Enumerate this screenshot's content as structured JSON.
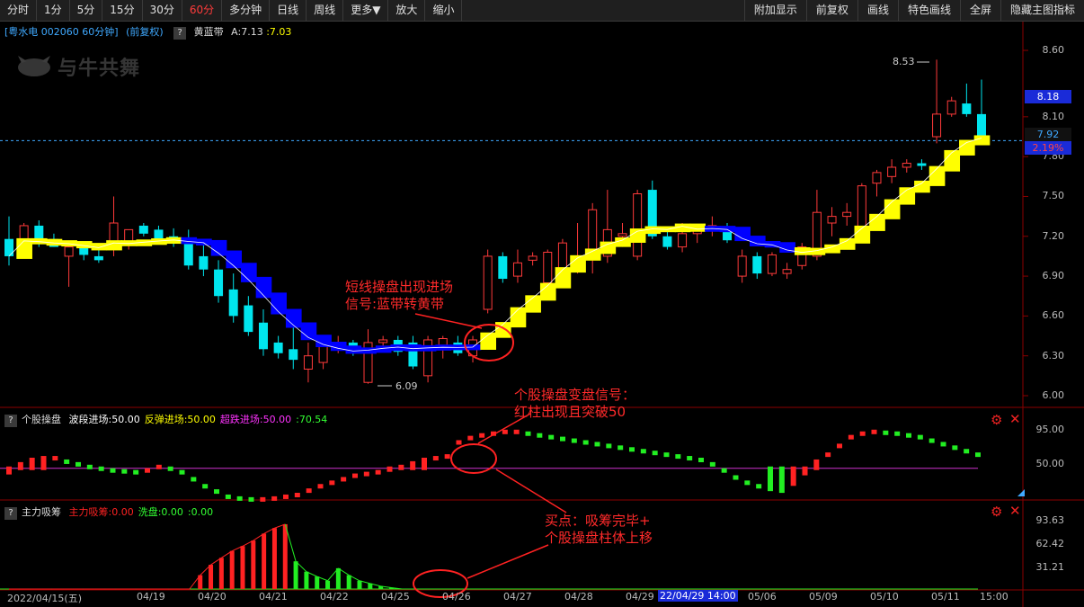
{
  "toolbar": {
    "left_items": [
      "分时",
      "1分",
      "5分",
      "15分",
      "30分",
      "60分",
      "多分钟",
      "日线",
      "周线",
      "更多▼",
      "放大",
      "缩小"
    ],
    "active": "60分",
    "right_items": [
      "附加显示",
      "前复权",
      "画线",
      "特色画线",
      "全屏",
      "隐藏主图指标"
    ]
  },
  "main_legend": {
    "stock": "[粤水电 002060 60分钟]",
    "adjust": "(前复权)",
    "indicator": "黄蓝带",
    "a_label": "A:7.13",
    "b_label": ":7.03"
  },
  "watermark": "与牛共舞",
  "price_axis": {
    "labels": [
      "8.60",
      "8.10",
      "7.80",
      "7.50",
      "7.20",
      "6.90",
      "6.60",
      "6.30",
      "6.00"
    ]
  },
  "price_tags": {
    "high": "8.18",
    "last": "7.92",
    "pct": "2.19%"
  },
  "price_annotations": {
    "high_mark": "8.53",
    "low_mark": "6.09"
  },
  "panel2": {
    "name": "个股操盘",
    "items": [
      {
        "label": "波段进场:50.00",
        "color": "#ffffff"
      },
      {
        "label": "反弹进场:50.00",
        "color": "#ffff00"
      },
      {
        "label": "超跌进场:50.00",
        "color": "#ff33ff"
      },
      {
        "label": ":70.54",
        "color": "#33ff33"
      }
    ],
    "axis": [
      "95.00",
      "50.00"
    ]
  },
  "panel3": {
    "name": "主力吸筹",
    "items": [
      {
        "label": "主力吸筹:0.00",
        "color": "#ff2222"
      },
      {
        "label": "洗盘:0.00",
        "color": "#33ff33"
      },
      {
        "label": ":0.00",
        "color": "#33ff33"
      }
    ],
    "axis": [
      "93.63",
      "62.42",
      "31.21"
    ]
  },
  "x_axis": {
    "labels": [
      "2022/04/15(五)",
      "04/19",
      "04/20",
      "04/21",
      "04/22",
      "04/25",
      "04/26",
      "04/27",
      "04/28",
      "04/29",
      "05/06",
      "05/09",
      "05/10",
      "05/11",
      "15:00"
    ],
    "cursor_label": "22/04/29 14:00"
  },
  "annotations": {
    "signal1": [
      "短线操盘出现进场",
      "信号:蓝带转黄带"
    ],
    "signal2": [
      "个股操盘变盘信号：",
      "红柱出现且突破50"
    ],
    "signal3": [
      "买点：吸筹完毕+",
      "个股操盘柱体上移"
    ]
  },
  "colors": {
    "up": "#ff3a3a",
    "down": "#00e5ee",
    "yellow_band": "#ffff00",
    "blue_band": "#0000ff",
    "grid": "#8b0000"
  },
  "chart_data": {
    "type": "candlestick",
    "ohlc": [
      [
        7.18,
        7.35,
        6.98,
        7.05
      ],
      [
        7.15,
        7.3,
        7.05,
        7.28
      ],
      [
        7.28,
        7.32,
        7.12,
        7.15
      ],
      [
        7.18,
        7.22,
        7.12,
        7.12
      ],
      [
        7.05,
        7.15,
        6.82,
        7.12
      ],
      [
        7.12,
        7.16,
        7.02,
        7.06
      ],
      [
        7.05,
        7.12,
        7.0,
        7.02
      ],
      [
        7.12,
        7.5,
        7.05,
        7.3
      ],
      [
        7.15,
        7.25,
        7.1,
        7.25
      ],
      [
        7.28,
        7.3,
        7.2,
        7.22
      ],
      [
        7.25,
        7.28,
        7.15,
        7.18
      ],
      [
        7.2,
        7.26,
        7.12,
        7.18
      ],
      [
        7.15,
        7.25,
        6.95,
        6.98
      ],
      [
        7.05,
        7.15,
        6.9,
        6.95
      ],
      [
        6.95,
        7.02,
        6.7,
        6.75
      ],
      [
        6.8,
        6.92,
        6.55,
        6.6
      ],
      [
        6.68,
        6.75,
        6.45,
        6.48
      ],
      [
        6.55,
        6.65,
        6.3,
        6.35
      ],
      [
        6.4,
        6.45,
        6.28,
        6.32
      ],
      [
        6.35,
        6.55,
        6.2,
        6.27
      ],
      [
        6.2,
        6.4,
        6.1,
        6.3
      ],
      [
        6.25,
        6.4,
        6.2,
        6.38
      ],
      [
        6.38,
        6.45,
        6.32,
        6.4
      ],
      [
        6.4,
        6.42,
        6.3,
        6.33
      ],
      [
        6.1,
        6.5,
        6.09,
        6.4
      ],
      [
        6.4,
        6.45,
        6.35,
        6.42
      ],
      [
        6.42,
        6.45,
        6.3,
        6.33
      ],
      [
        6.4,
        6.45,
        6.2,
        6.22
      ],
      [
        6.15,
        6.45,
        6.1,
        6.42
      ],
      [
        6.38,
        6.45,
        6.28,
        6.43
      ],
      [
        6.4,
        6.45,
        6.3,
        6.32
      ],
      [
        6.3,
        6.45,
        6.25,
        6.42
      ],
      [
        6.65,
        7.1,
        6.62,
        7.05
      ],
      [
        7.05,
        7.08,
        6.85,
        6.88
      ],
      [
        6.9,
        7.1,
        6.85,
        7.0
      ],
      [
        7.02,
        7.08,
        6.98,
        7.05
      ],
      [
        6.85,
        7.1,
        6.8,
        7.08
      ],
      [
        6.9,
        7.18,
        6.85,
        7.15
      ],
      [
        6.95,
        7.3,
        6.92,
        7.05
      ],
      [
        7.05,
        7.45,
        6.92,
        7.4
      ],
      [
        7.05,
        7.55,
        7.0,
        7.25
      ],
      [
        7.2,
        7.3,
        7.12,
        7.22
      ],
      [
        7.05,
        7.55,
        7.02,
        7.52
      ],
      [
        7.55,
        7.62,
        7.18,
        7.2
      ],
      [
        7.2,
        7.25,
        7.1,
        7.12
      ],
      [
        7.12,
        7.3,
        7.08,
        7.22
      ],
      [
        7.22,
        7.28,
        7.15,
        7.25
      ],
      [
        7.25,
        7.35,
        7.2,
        7.28
      ],
      [
        7.25,
        7.3,
        7.15,
        7.17
      ],
      [
        6.9,
        7.1,
        6.85,
        7.05
      ],
      [
        7.05,
        7.08,
        6.88,
        6.92
      ],
      [
        6.92,
        7.08,
        6.9,
        7.06
      ],
      [
        6.92,
        7.0,
        6.88,
        6.95
      ],
      [
        6.98,
        7.15,
        6.95,
        7.12
      ],
      [
        7.05,
        7.55,
        7.02,
        7.38
      ],
      [
        7.3,
        7.42,
        7.2,
        7.35
      ],
      [
        7.35,
        7.45,
        7.28,
        7.38
      ],
      [
        7.25,
        7.6,
        7.2,
        7.58
      ],
      [
        7.6,
        7.7,
        7.5,
        7.68
      ],
      [
        7.65,
        7.78,
        7.6,
        7.72
      ],
      [
        7.72,
        7.78,
        7.68,
        7.75
      ],
      [
        7.75,
        7.78,
        7.7,
        7.73
      ],
      [
        7.95,
        8.53,
        7.9,
        8.12
      ],
      [
        8.12,
        8.25,
        8.1,
        8.22
      ],
      [
        8.2,
        8.35,
        8.1,
        8.12
      ],
      [
        8.12,
        8.38,
        7.9,
        7.92
      ]
    ],
    "panel2_values": [
      45,
      55,
      60,
      62,
      62,
      58,
      55,
      52,
      50,
      48,
      47,
      46,
      48,
      52,
      50,
      46,
      38,
      30,
      24,
      18,
      16,
      15,
      15,
      16,
      18,
      20,
      25,
      30,
      34,
      38,
      42,
      44,
      46,
      48,
      52,
      56,
      60,
      62,
      64,
      80,
      85,
      88,
      90,
      92,
      92,
      90,
      88,
      86,
      84,
      82,
      80,
      78,
      76,
      74,
      72,
      70,
      68,
      66,
      64,
      62,
      60,
      55,
      48,
      40,
      34,
      30,
      26,
      24,
      32,
      44,
      58,
      66,
      76,
      86,
      90,
      92,
      91,
      90,
      88,
      86,
      82,
      78,
      74,
      70,
      66
    ],
    "panel2_axis_range": [
      20,
      100
    ],
    "panel3_values": [
      0,
      0,
      0,
      0,
      0,
      0,
      0,
      0,
      0,
      0,
      0,
      0,
      0,
      0,
      0,
      0,
      0,
      0,
      20,
      35,
      45,
      55,
      62,
      70,
      80,
      88,
      93.6,
      40,
      25,
      18,
      12,
      30,
      20,
      12,
      8,
      4,
      2,
      0,
      0,
      0,
      0,
      0,
      0,
      0,
      0
    ],
    "panel3_red_until_index": 26,
    "panel3_axis_range": [
      0,
      100
    ]
  }
}
